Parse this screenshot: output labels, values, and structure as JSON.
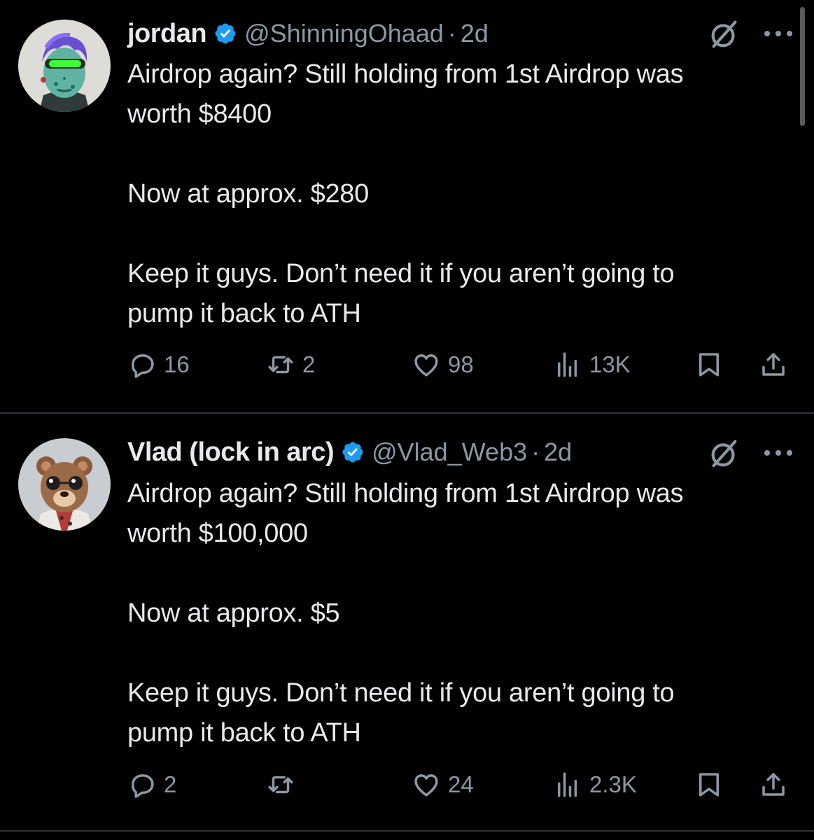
{
  "tweets": [
    {
      "name": "jordan",
      "handle": "@ShinningOhaad",
      "separator": "·",
      "time": "2d",
      "lines": [
        "Airdrop again? Still holding from 1st Airdrop was",
        "worth $8400",
        "",
        "Now at approx. $280",
        "",
        "Keep it guys. Don’t need it if you aren’t going to",
        "pump it back to ATH"
      ],
      "replies": "16",
      "reposts": "2",
      "likes": "98",
      "views": "13K"
    },
    {
      "name": "Vlad (lock in arc)",
      "handle": "@Vlad_Web3",
      "separator": "·",
      "time": "2d",
      "lines": [
        "Airdrop again? Still holding from 1st Airdrop was",
        "worth $100,000",
        "",
        "Now at approx. $5",
        "",
        "Keep it guys. Don’t need it if you aren’t going to",
        "pump it back to ATH"
      ],
      "replies": "2",
      "reposts": "",
      "likes": "24",
      "views": "2.3K"
    }
  ],
  "icons": {
    "verified": "verified-badge-icon",
    "grok": "grok-icon",
    "more": "more-icon",
    "reply": "reply-icon",
    "repost": "repost-icon",
    "like": "like-icon",
    "views": "views-icon",
    "bookmark": "bookmark-icon",
    "share": "share-icon"
  },
  "colors": {
    "background": "#000000",
    "text": "#e7e9ea",
    "secondary": "#8b98a5",
    "verified": "#1d9bf0",
    "divider": "#2f3336"
  }
}
